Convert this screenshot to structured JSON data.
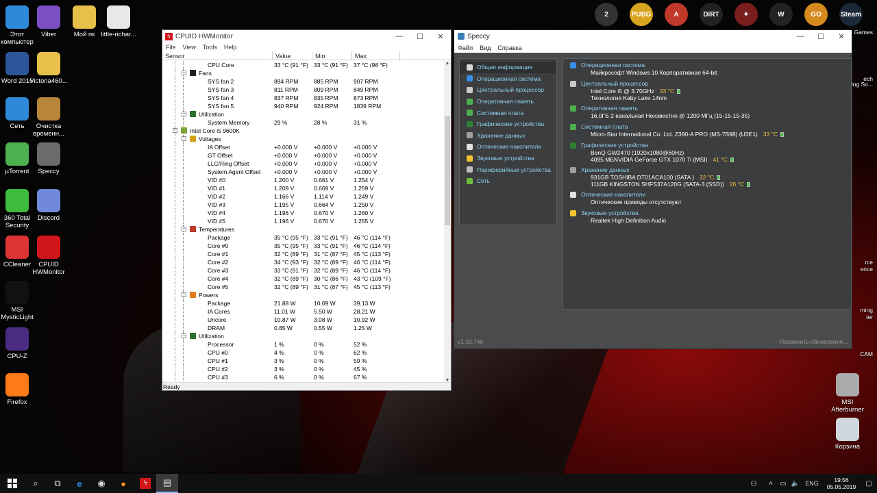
{
  "desktop_icons": [
    {
      "label": "Этот компьютер",
      "icon": "computer-icon"
    },
    {
      "label": "Viber",
      "icon": "viber-icon"
    },
    {
      "label": "Мой пк",
      "icon": "folder-icon"
    },
    {
      "label": "little-richar...",
      "icon": "file-icon"
    },
    {
      "label": "Word 2016",
      "icon": "word-icon"
    },
    {
      "label": "Victoria460...",
      "icon": "folder-icon"
    },
    {
      "label": "Сеть",
      "icon": "network-icon"
    },
    {
      "label": "Очистка временн...",
      "icon": "broom-icon"
    },
    {
      "label": "µTorrent",
      "icon": "utorrent-icon"
    },
    {
      "label": "Speccy",
      "icon": "speccy-icon"
    },
    {
      "label": "360 Total Security",
      "icon": "security-icon"
    },
    {
      "label": "Discord",
      "icon": "discord-icon"
    },
    {
      "label": "CCleaner",
      "icon": "ccleaner-icon"
    },
    {
      "label": "CPUID HWMonitor",
      "icon": "hwmonitor-icon"
    },
    {
      "label": "MSI MysticLight",
      "icon": "rgb-icon"
    },
    {
      "label": "CPU-Z",
      "icon": "cpuz-icon"
    },
    {
      "label": "Firefox",
      "icon": "firefox-icon"
    },
    {
      "label": "MSI Afterburner",
      "icon": "afterburner-icon"
    },
    {
      "label": "Корзина",
      "icon": "recycle-bin-icon"
    }
  ],
  "hwmonitor": {
    "title": "CPUID HWMonitor",
    "menu": [
      "File",
      "View",
      "Tools",
      "Help"
    ],
    "columns": [
      "Sensor",
      "Value",
      "Min",
      "Max"
    ],
    "status": "Ready",
    "rows": [
      {
        "name": "CPU Core",
        "v": "33 °C  (91 °F)",
        "mn": "33 °C  (91 °F)",
        "mx": "37 °C  (98 °F)",
        "lvl": 3
      },
      {
        "name": "Fans",
        "lvl": 2,
        "group": true
      },
      {
        "name": "SYS fan 2",
        "v": "894 RPM",
        "mn": "885 RPM",
        "mx": "907 RPM",
        "lvl": 3
      },
      {
        "name": "SYS fan 3",
        "v": "811 RPM",
        "mn": "809 RPM",
        "mx": "849 RPM",
        "lvl": 3
      },
      {
        "name": "SYS fan 4",
        "v": "837 RPM",
        "mn": "835 RPM",
        "mx": "873 RPM",
        "lvl": 3
      },
      {
        "name": "SYS fan 5",
        "v": "940 RPM",
        "mn": "924 RPM",
        "mx": "1839 RPM",
        "lvl": 3
      },
      {
        "name": "Utilization",
        "lvl": 2,
        "group": true
      },
      {
        "name": "System Memory",
        "v": "29 %",
        "mn": "28 %",
        "mx": "31 %",
        "lvl": 3
      },
      {
        "name": "Intel Core i5 9600K",
        "lvl": 1,
        "group": true
      },
      {
        "name": "Voltages",
        "lvl": 2,
        "group": true
      },
      {
        "name": "IA Offset",
        "v": "+0.000 V",
        "mn": "+0.000 V",
        "mx": "+0.000 V",
        "lvl": 3
      },
      {
        "name": "GT Offset",
        "v": "+0.000 V",
        "mn": "+0.000 V",
        "mx": "+0.000 V",
        "lvl": 3
      },
      {
        "name": "LLC/Ring Offset",
        "v": "+0.000 V",
        "mn": "+0.000 V",
        "mx": "+0.000 V",
        "lvl": 3
      },
      {
        "name": "System Agent Offset",
        "v": "+0.000 V",
        "mn": "+0.000 V",
        "mx": "+0.000 V",
        "lvl": 3
      },
      {
        "name": "VID #0",
        "v": "1.200 V",
        "mn": "0.661 V",
        "mx": "1.254 V",
        "lvl": 3
      },
      {
        "name": "VID #1",
        "v": "1.209 V",
        "mn": "0.669 V",
        "mx": "1.259 V",
        "lvl": 3
      },
      {
        "name": "VID #2",
        "v": "1.166 V",
        "mn": "1.114 V",
        "mx": "1.249 V",
        "lvl": 3
      },
      {
        "name": "VID #3",
        "v": "1.195 V",
        "mn": "0.664 V",
        "mx": "1.250 V",
        "lvl": 3
      },
      {
        "name": "VID #4",
        "v": "1.196 V",
        "mn": "0.670 V",
        "mx": "1.260 V",
        "lvl": 3
      },
      {
        "name": "VID #5",
        "v": "1.196 V",
        "mn": "0.670 V",
        "mx": "1.255 V",
        "lvl": 3
      },
      {
        "name": "Temperatures",
        "lvl": 2,
        "group": true
      },
      {
        "name": "Package",
        "v": "35 °C  (95 °F)",
        "mn": "33 °C  (91 °F)",
        "mx": "46 °C  (114 °F)",
        "lvl": 3
      },
      {
        "name": "Core #0",
        "v": "35 °C  (95 °F)",
        "mn": "33 °C  (91 °F)",
        "mx": "46 °C  (114 °F)",
        "lvl": 3
      },
      {
        "name": "Core #1",
        "v": "32 °C  (89 °F)",
        "mn": "31 °C  (87 °F)",
        "mx": "45 °C  (113 °F)",
        "lvl": 3
      },
      {
        "name": "Core #2",
        "v": "34 °C  (93 °F)",
        "mn": "32 °C  (89 °F)",
        "mx": "46 °C  (114 °F)",
        "lvl": 3
      },
      {
        "name": "Core #3",
        "v": "33 °C  (91 °F)",
        "mn": "32 °C  (89 °F)",
        "mx": "46 °C  (114 °F)",
        "lvl": 3
      },
      {
        "name": "Core #4",
        "v": "32 °C  (89 °F)",
        "mn": "30 °C  (86 °F)",
        "mx": "43 °C  (109 °F)",
        "lvl": 3
      },
      {
        "name": "Core #5",
        "v": "32 °C  (89 °F)",
        "mn": "31 °C  (87 °F)",
        "mx": "45 °C  (113 °F)",
        "lvl": 3
      },
      {
        "name": "Powers",
        "lvl": 2,
        "group": true
      },
      {
        "name": "Package",
        "v": "21.88 W",
        "mn": "10.09 W",
        "mx": "39.13 W",
        "lvl": 3
      },
      {
        "name": "IA Cores",
        "v": "11.01 W",
        "mn": "5.50 W",
        "mx": "28.21 W",
        "lvl": 3
      },
      {
        "name": "Uncore",
        "v": "10.87 W",
        "mn": "3.08 W",
        "mx": "10.92 W",
        "lvl": 3
      },
      {
        "name": "DRAM",
        "v": "0.85 W",
        "mn": "0.55 W",
        "mx": "1.25 W",
        "lvl": 3
      },
      {
        "name": "Utilization",
        "lvl": 2,
        "group": true
      },
      {
        "name": "Processor",
        "v": "1 %",
        "mn": "0 %",
        "mx": "52 %",
        "lvl": 3
      },
      {
        "name": "CPU #0",
        "v": "4 %",
        "mn": "0 %",
        "mx": "62 %",
        "lvl": 3
      },
      {
        "name": "CPU #1",
        "v": "3 %",
        "mn": "0 %",
        "mx": "59 %",
        "lvl": 3
      },
      {
        "name": "CPU #2",
        "v": "3 %",
        "mn": "0 %",
        "mx": "45 %",
        "lvl": 3
      },
      {
        "name": "CPU #3",
        "v": "6 %",
        "mn": "0 %",
        "mx": "67 %",
        "lvl": 3
      }
    ]
  },
  "speccy": {
    "title": "Speccy",
    "menu": [
      "Файл",
      "Вид",
      "Справка"
    ],
    "version": "v1.32.740",
    "update_link": "Проверить обновления...",
    "nav": [
      {
        "label": "Общая информация",
        "color": "#d8d8d8"
      },
      {
        "label": "Операционная система",
        "color": "#3b8ee8"
      },
      {
        "label": "Центральный процессор",
        "color": "#c9c9c9"
      },
      {
        "label": "Оперативная память",
        "color": "#4caf50"
      },
      {
        "label": "Системная плата",
        "color": "#4caf50"
      },
      {
        "label": "Графические устройства",
        "color": "#2e7d32"
      },
      {
        "label": "Хранение данных",
        "color": "#9e9e9e"
      },
      {
        "label": "Оптические накопители",
        "color": "#e0e0e0"
      },
      {
        "label": "Звуковые устройства",
        "color": "#f2c230"
      },
      {
        "label": "Периферийные устройства",
        "color": "#bdbdbd"
      },
      {
        "label": "Сеть",
        "color": "#6abf3b"
      }
    ],
    "sections": [
      {
        "head": "Операционная система",
        "lines": [
          {
            "text": "Майкрософт Windows 10 Корпоративная 64-bit"
          }
        ],
        "color": "#3b8ee8"
      },
      {
        "head": "Центральный процессор",
        "lines": [
          {
            "text": "Intel Core i5 @ 3.70GHz",
            "temp": "33 °C"
          },
          {
            "text": "Технология Kaby Lake 14nm"
          }
        ],
        "color": "#c9c9c9"
      },
      {
        "head": "Оперативная память",
        "lines": [
          {
            "text": "16,0ГБ 2-канальная Неизвестно @ 1200 МГц (15-15-15-35)"
          }
        ],
        "color": "#4caf50"
      },
      {
        "head": "Системная плата",
        "lines": [
          {
            "text": "Micro-Star International Co. Ltd. Z390-A PRO (MS-7B98) (U3E1)",
            "temp": "33 °C"
          }
        ],
        "color": "#4caf50"
      },
      {
        "head": "Графические устройства",
        "lines": [
          {
            "text": "BenQ GW2470 (1920x1080@60Hz)"
          },
          {
            "text": "4095 МБNVIDIA GeForce GTX 1070 Ti (MSI)",
            "temp": "41 °C"
          }
        ],
        "color": "#2e7d32"
      },
      {
        "head": "Хранение данных",
        "lines": [
          {
            "text": "931GB TOSHIBA DT01ACA100 (SATA )",
            "temp": "32 °C"
          },
          {
            "text": "111GB KINGSTON SHFS37A120G (SATA-3 (SSD))",
            "temp": "26 °C"
          }
        ],
        "color": "#9e9e9e"
      },
      {
        "head": "Оптические накопители",
        "lines": [
          {
            "text": "Оптические приводы отсутствуют"
          }
        ],
        "color": "#e0e0e0"
      },
      {
        "head": "Звуковые устройства",
        "lines": [
          {
            "text": "Realtek High Definition Audio"
          }
        ],
        "color": "#f2c230"
      }
    ]
  },
  "top_right_icons": [
    {
      "label": "2",
      "icon": "overwatch-icon",
      "color": "#333"
    },
    {
      "label": "PUBG",
      "icon": "pubg-icon",
      "color": "#d9a520"
    },
    {
      "label": "A",
      "icon": "apex-icon",
      "color": "#c0392b"
    },
    {
      "label": "DiRT",
      "icon": "dirt-icon",
      "color": "#222"
    },
    {
      "label": "✦",
      "icon": "game-icon",
      "color": "#7a1d1d"
    },
    {
      "label": "W",
      "icon": "wot-icon",
      "color": "#222"
    },
    {
      "label": "GO",
      "icon": "csgo-icon",
      "color": "#d68a1e"
    },
    {
      "label": "Steam",
      "icon": "steam-icon",
      "color": "#1b2838"
    }
  ],
  "right_edge_labels": [
    "Games",
    "ech",
    "ing So...",
    "rce",
    "ence",
    "ming",
    "ter",
    "CAM"
  ],
  "taskbar": {
    "lang": "ENG",
    "time": "19:56",
    "date": "05.05.2019"
  }
}
